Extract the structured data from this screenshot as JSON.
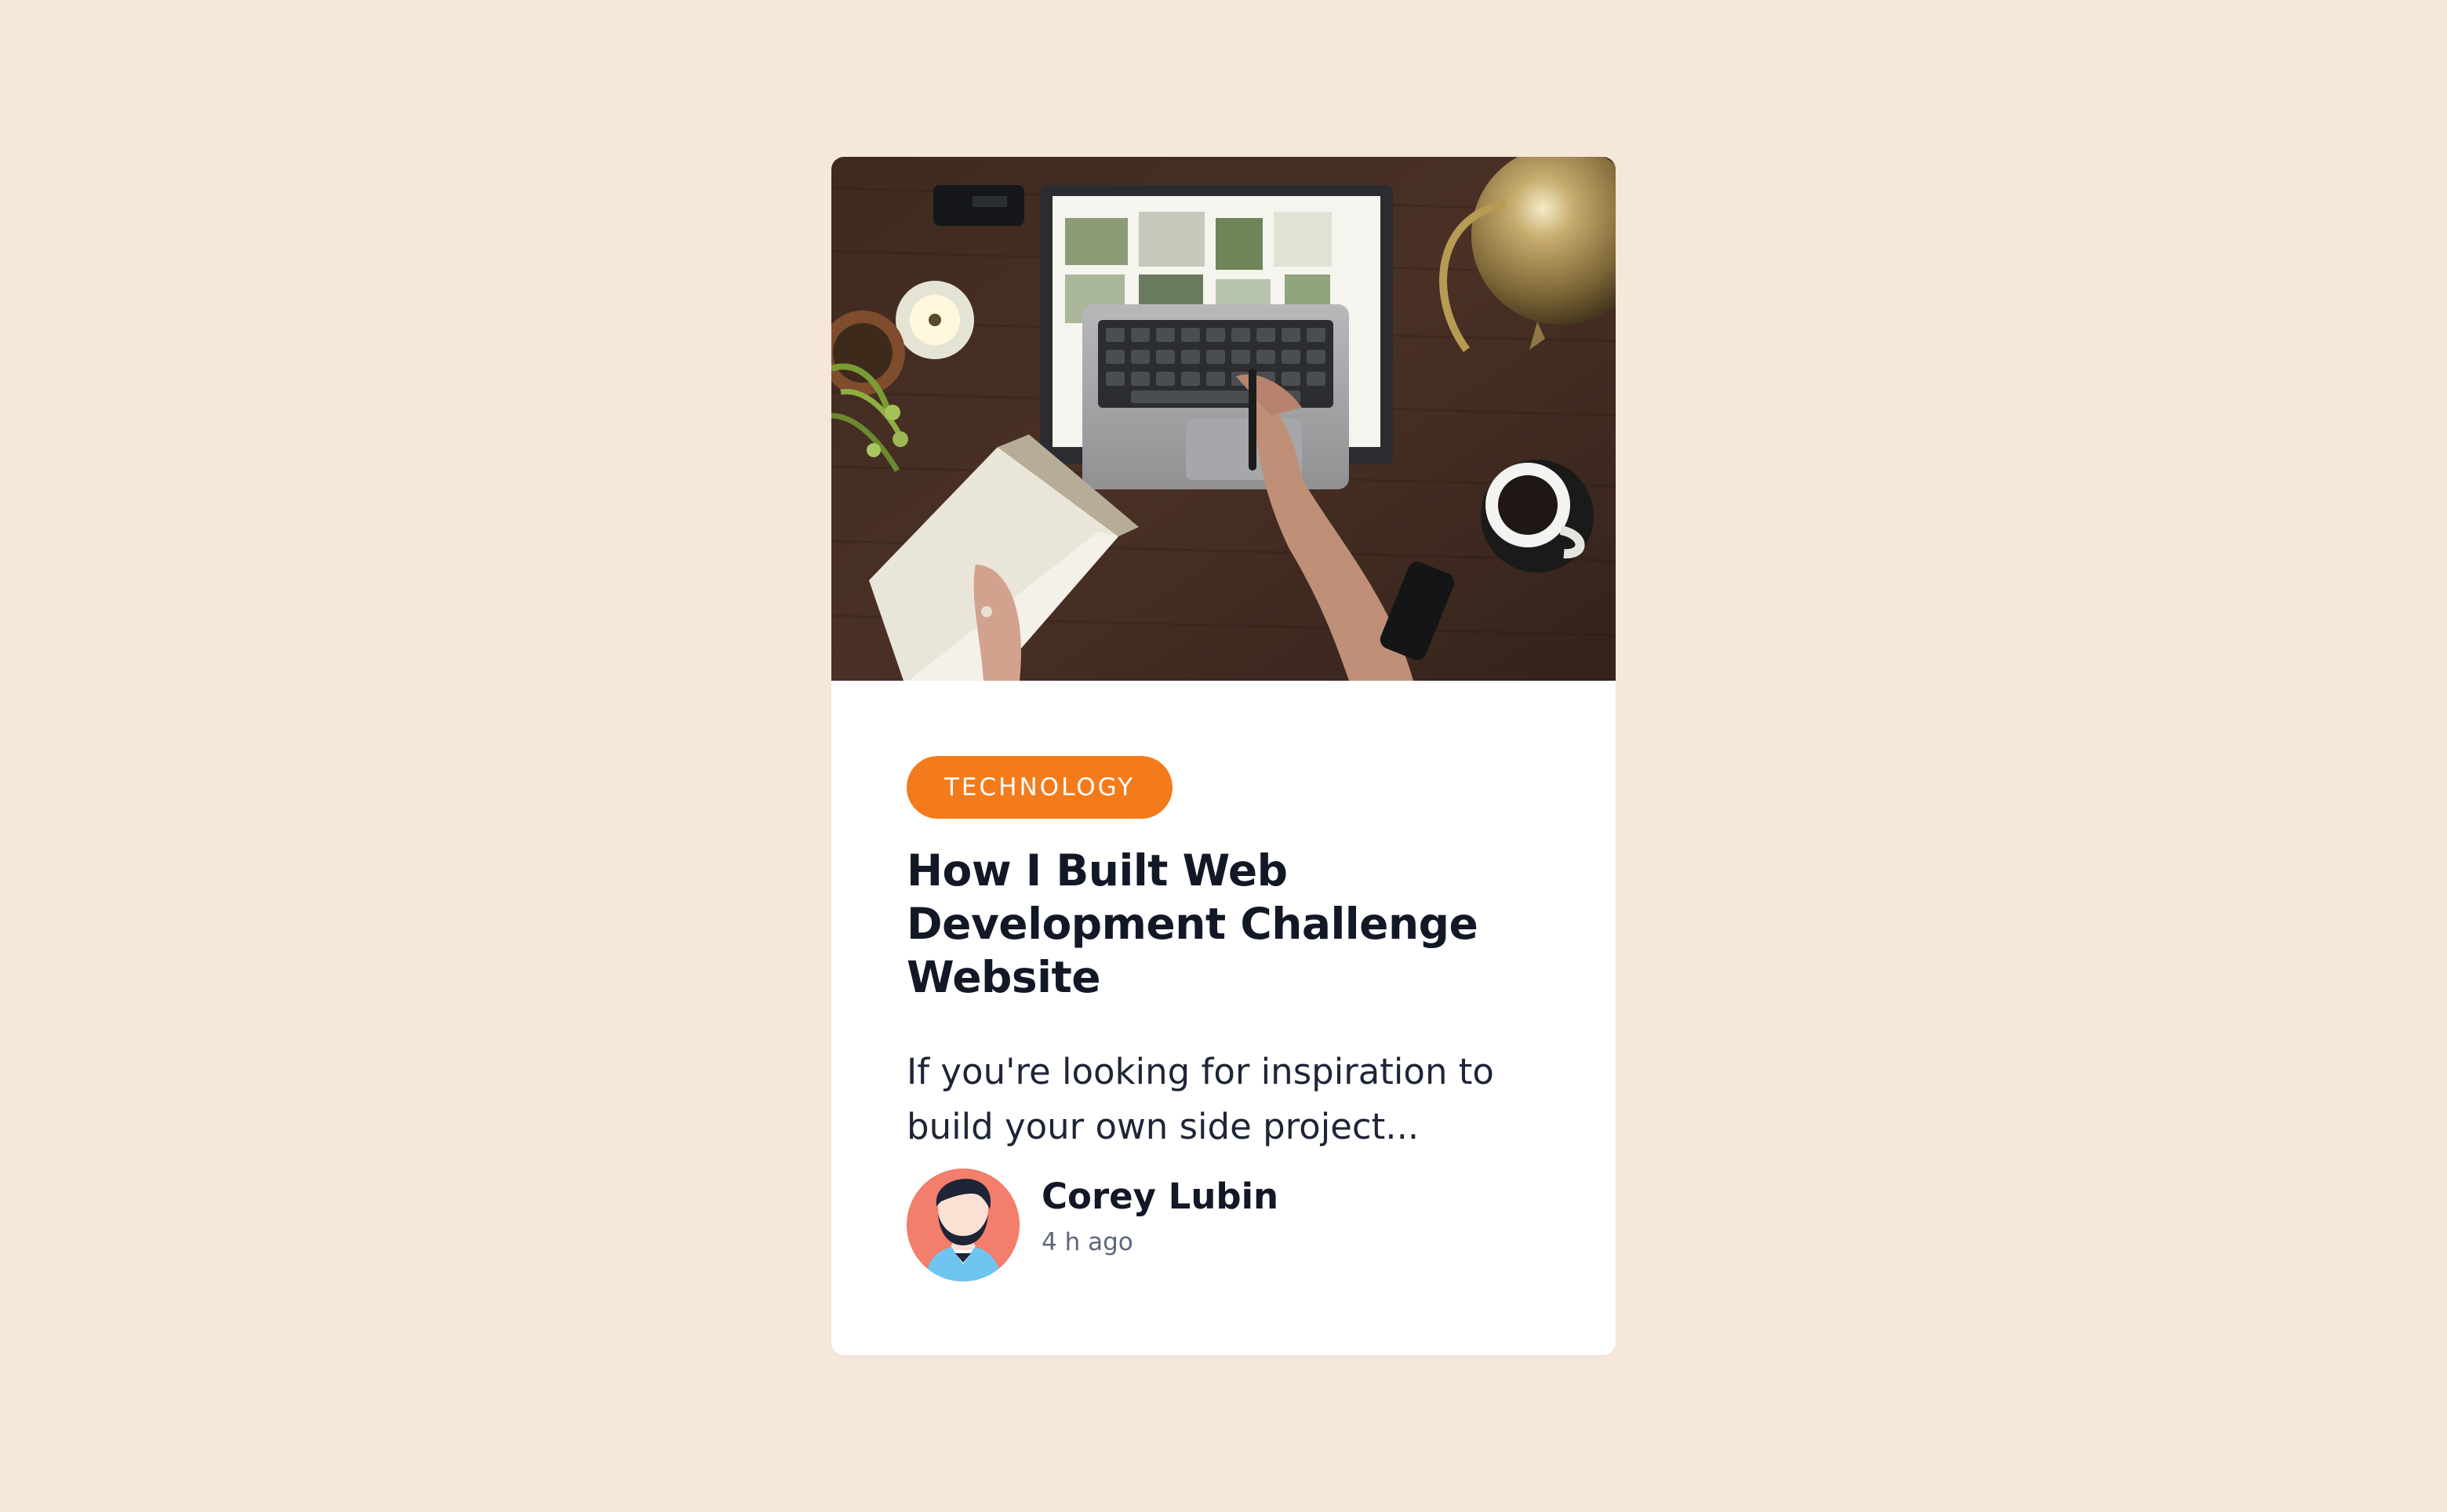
{
  "page": {
    "background_color": "#f5e7da"
  },
  "card": {
    "image": {
      "icon": "desk-laptop-photo"
    },
    "tag": {
      "label": "TECHNOLOGY",
      "color": "#f47b1b"
    },
    "title": "How I Built Web Development Challenge Website",
    "excerpt": "If you're looking for inspiration to build your own side project...",
    "author": {
      "name": "Corey Lubin",
      "time": "4 h ago",
      "avatar_icon": "avatar-man-beard-icon",
      "avatar_bg": "#f27e6b"
    }
  }
}
